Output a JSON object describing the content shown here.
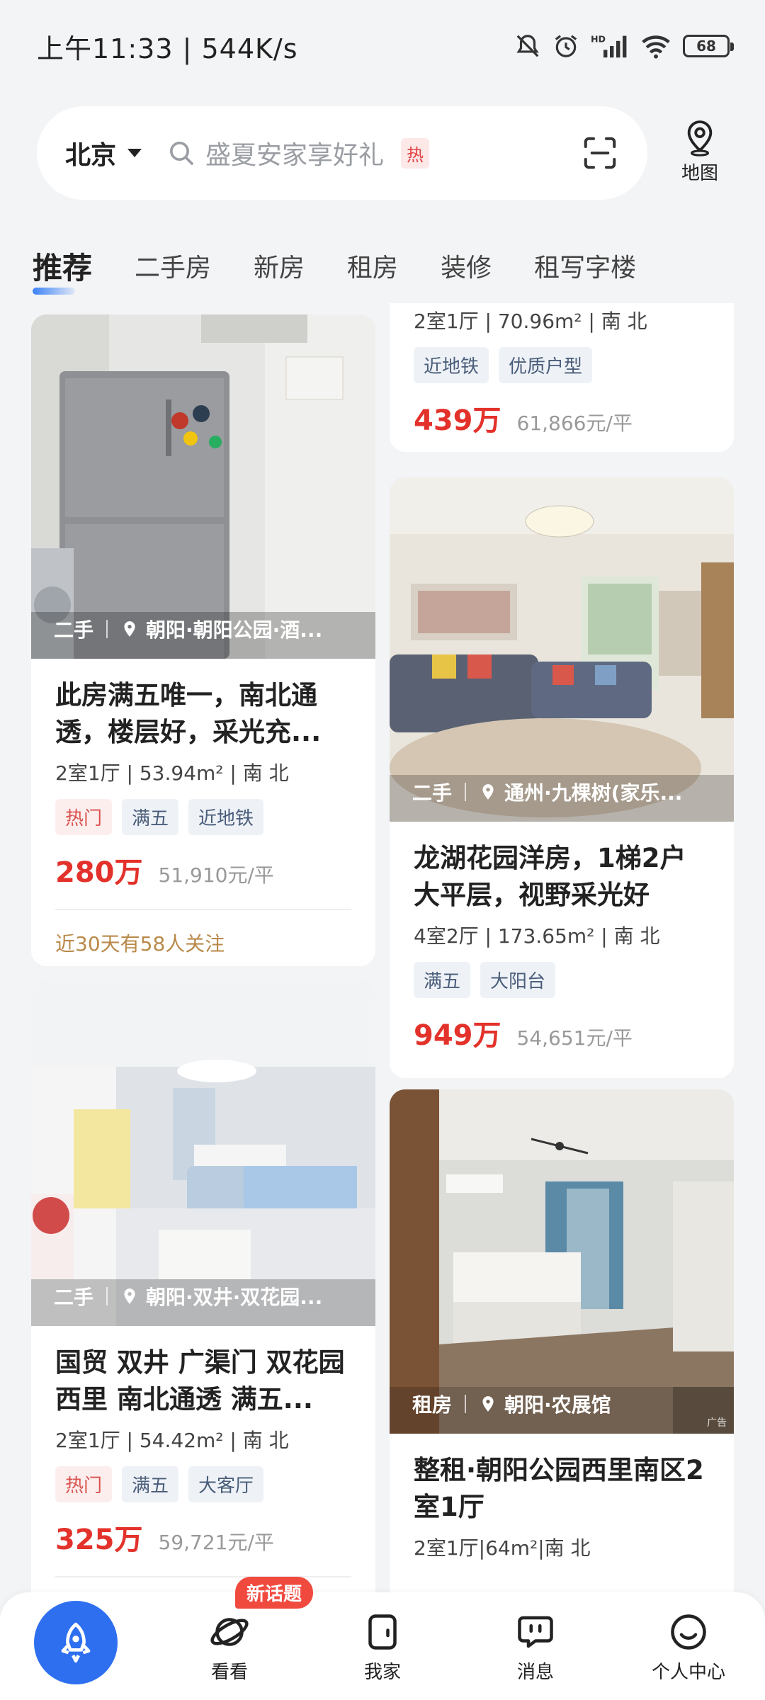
{
  "status_bar": {
    "time": "上午11:33 | 544K/s",
    "battery": "68"
  },
  "search": {
    "city": "北京",
    "placeholder": "盛夏安家享好礼",
    "hot_badge": "热",
    "map_label": "地图"
  },
  "tabs": [
    {
      "label": "推荐"
    },
    {
      "label": "二手房"
    },
    {
      "label": "新房"
    },
    {
      "label": "租房"
    },
    {
      "label": "装修"
    },
    {
      "label": "租写字楼"
    }
  ],
  "listings": {
    "left1": {
      "category": "二手",
      "location": "朝阳·朝阳公园·酒...",
      "title": "此房满五唯一，南北通透，楼层好，采光充...",
      "meta": "2室1厅 | 53.94m² | 南 北",
      "tags": [
        "热门",
        "满五",
        "近地铁"
      ],
      "price": "280万",
      "unit_price": "51,910元/平",
      "follow": "近30天有58人关注"
    },
    "left2": {
      "category": "二手",
      "location": "朝阳·双井·双花园...",
      "title": "国贸 双井 广渠门 双花园西里 南北通透 满五...",
      "meta": "2室1厅 | 54.42m² | 南 北",
      "tags": [
        "热门",
        "满五",
        "大客厅"
      ],
      "price": "325万",
      "unit_price": "59,721元/平"
    },
    "right0": {
      "meta": "2室1厅 | 70.96m² | 南 北",
      "tags": [
        "近地铁",
        "优质户型"
      ],
      "price": "439万",
      "unit_price": "61,866元/平"
    },
    "right1": {
      "category": "二手",
      "location": "通州·九棵树(家乐...",
      "title": "龙湖花园洋房，1梯2户大平层，视野采光好",
      "meta": "4室2厅 | 173.65m² | 南 北",
      "tags": [
        "满五",
        "大阳台"
      ],
      "price": "949万",
      "unit_price": "54,651元/平"
    },
    "right2": {
      "category": "租房",
      "location": "朝阳·农展馆",
      "ad": "广告",
      "title": "整租·朝阳公园西里南区2室1厅",
      "meta": "2室1厅|64m²|南 北"
    }
  },
  "bottom_nav": {
    "items": [
      {
        "label": "看看"
      },
      {
        "label": "我家"
      },
      {
        "label": "消息"
      },
      {
        "label": "个人中心"
      }
    ],
    "new_topic_badge": "新话题"
  },
  "colors": {
    "accent": "#2e6ff0",
    "price_red": "#e3322b",
    "background": "#f3f4f6"
  }
}
